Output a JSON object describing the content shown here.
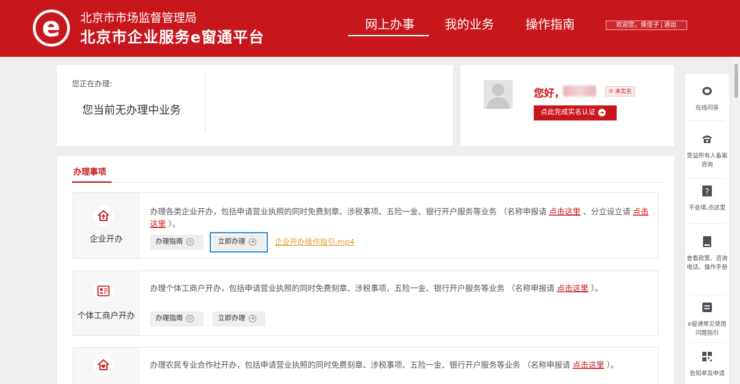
{
  "header": {
    "org_name": "北京市市场监督管理局",
    "platform_name": "北京市企业服务e窗通平台",
    "nav": [
      "网上办事",
      "我的业务",
      "操作指南"
    ],
    "welcome": "欢迎您，侯佳子",
    "logout": "退出",
    "brand_color": "#c8161d"
  },
  "processing": {
    "label": "您正在办理:",
    "value": "您当前无办理中业务"
  },
  "profile": {
    "greeting": "您好，",
    "status_badge": "⑦ 未实名",
    "verify_button": "点此完成实名认证"
  },
  "items": {
    "title": "办理事项",
    "services": [
      {
        "name": "企业开办",
        "icon": "house-arrow-icon",
        "desc_pre": "办理各类企业开办，包括申请营业执照的同时免费刻章、涉税事项、五险一金、银行开户服务等业务 （名称申报请",
        "link1": "点击这里",
        "desc_mid": "、分立设立请",
        "link2": "点击这里",
        "desc_post": "）。",
        "guide_button": "办理指南",
        "apply_button": "立即办理",
        "video_link": "企业开办操作指引.mp4"
      },
      {
        "name": "个体工商户开办",
        "icon": "id-card-icon",
        "desc_pre": "办理个体工商户开办，包括申请营业执照的同时免费刻章、涉税事项、五险一金、银行开户服务等业务 （名称申报请",
        "link1": "点击这里",
        "desc_post": "）。",
        "guide_button": "办理指南",
        "apply_button": "立即办理"
      },
      {
        "icon": "house-heart-icon",
        "desc_pre": "办理农民专业合作社开办，包括申请营业执照的同时免费刻章、涉税事项、五险一金、银行开户服务等业务 （名称申报请",
        "link1": "点击这里",
        "desc_post": "）。"
      }
    ]
  },
  "sidebar": [
    {
      "icon": "chat-icon",
      "label": "在线问答"
    },
    {
      "icon": "phone-icon",
      "label": "受益所有人备案咨询"
    },
    {
      "icon": "question-icon",
      "label": "不会填,点这里"
    },
    {
      "icon": "book-icon",
      "label": "查看政策、咨询电话、操作手册"
    },
    {
      "icon": "list-icon",
      "label": "e窗通常见使用问题指引"
    },
    {
      "icon": "qrcode-icon",
      "label": "告知单及申请"
    }
  ]
}
